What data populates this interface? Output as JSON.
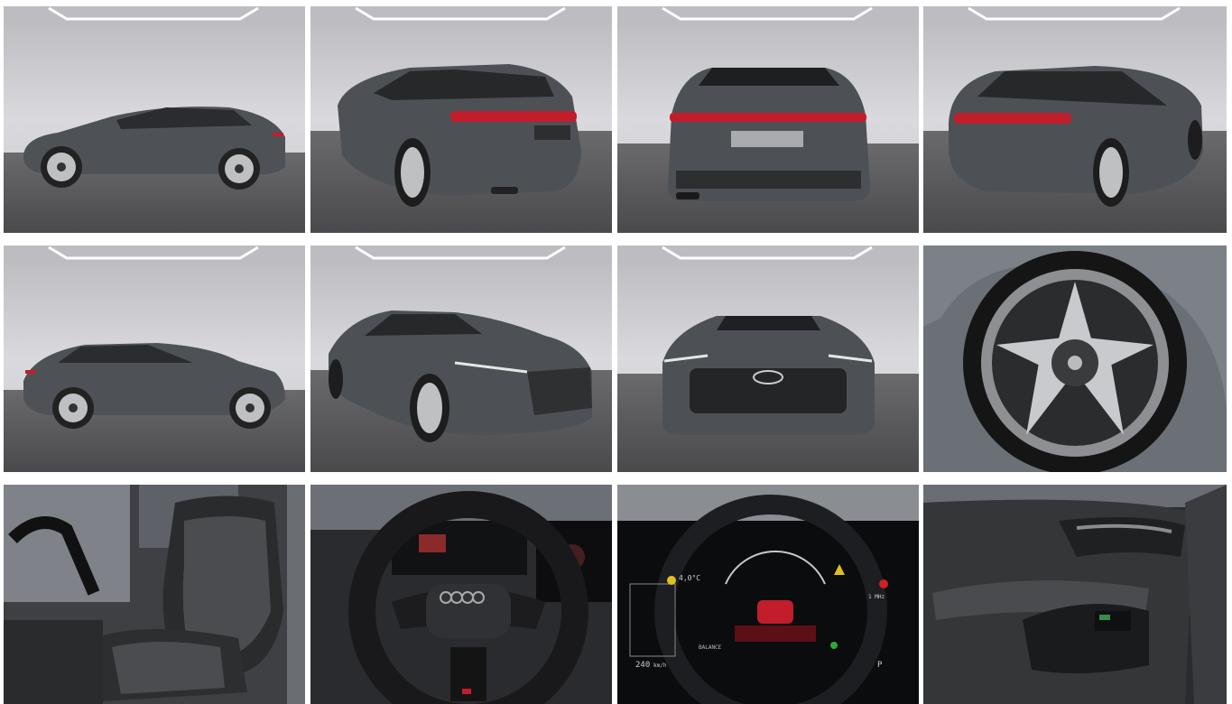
{
  "gallery": {
    "tiles": [
      {
        "icon": "car-side-left-photo"
      },
      {
        "icon": "car-rear-quarter-left-photo"
      },
      {
        "icon": "car-rear-photo"
      },
      {
        "icon": "car-rear-quarter-right-photo"
      },
      {
        "icon": "car-side-right-photo"
      },
      {
        "icon": "car-front-quarter-photo"
      },
      {
        "icon": "car-front-photo"
      },
      {
        "icon": "wheel-rim-photo"
      },
      {
        "icon": "front-seat-photo"
      },
      {
        "icon": "steering-wheel-photo"
      },
      {
        "icon": "instrument-cluster-photo"
      },
      {
        "icon": "door-panel-photo"
      }
    ]
  },
  "cluster": {
    "temperature": "4,0°C",
    "speed_max": "240",
    "speed_unit": "km/h",
    "mode_label": "BALANCE",
    "gear": "P",
    "range": "1 MHz"
  },
  "colors": {
    "studio_wall": "#cfced3",
    "studio_floor": "#565659",
    "car_body": "#4d5155",
    "tail_light": "#c21d2b"
  }
}
